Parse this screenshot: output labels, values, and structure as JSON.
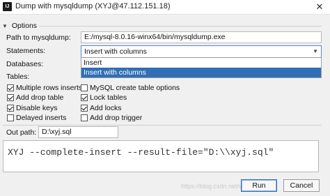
{
  "window": {
    "title": "Dump with mysqldump (XYJ@47.112.151.18)",
    "app_icon_text": "IJ",
    "close_glyph": "✕"
  },
  "options": {
    "header": "Options",
    "path_label": "Path to mysqldump:",
    "path_value": "E:/mysql-8.0.16-winx64/bin/mysqldump.exe",
    "statements_label": "Statements:",
    "statements_value": "Insert with columns",
    "statements_options": [
      "Insert",
      "Insert with columns"
    ],
    "databases_label": "Databases:",
    "tables_label": "Tables:"
  },
  "checkboxes": [
    {
      "label": "Multiple rows inserts",
      "checked": true
    },
    {
      "label": "MySQL create table options",
      "checked": false
    },
    {
      "label": "Add drop table",
      "checked": true
    },
    {
      "label": "Lock tables",
      "checked": true
    },
    {
      "label": "Disable keys",
      "checked": true
    },
    {
      "label": "Add locks",
      "checked": true
    },
    {
      "label": "Delayed inserts",
      "checked": false
    },
    {
      "label": "Add drop trigger",
      "checked": false
    }
  ],
  "output": {
    "label": "Out path:",
    "value": "D:\\xyj.sql",
    "command": "XYJ --complete-insert --result-file=\"D:\\\\xyj.sql\""
  },
  "buttons": {
    "run": "Run",
    "cancel": "Cancel"
  },
  "watermark": "https://blog.csdn.net/weixin_43..."
}
